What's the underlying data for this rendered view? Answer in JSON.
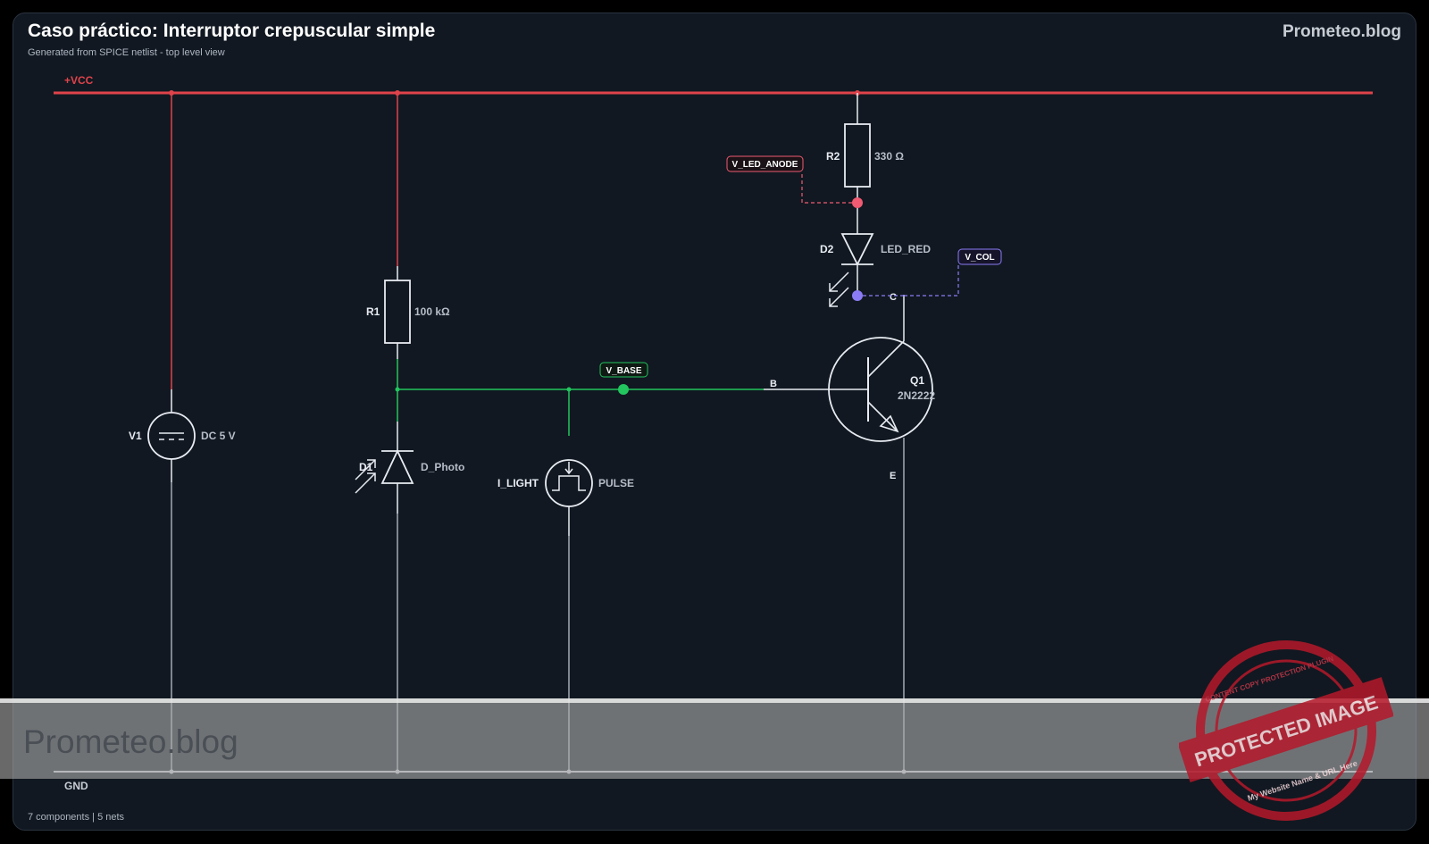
{
  "header": {
    "title": "Caso práctico: Interruptor crepuscular simple",
    "subtitle": "Generated from SPICE netlist - top level view",
    "brand": "Prometeo.blog"
  },
  "footer": {
    "stats": "7 components | 5 nets"
  },
  "rails": {
    "vcc": "+VCC",
    "gnd": "GND"
  },
  "components": {
    "v1": {
      "ref": "V1",
      "value": "DC 5 V"
    },
    "r1": {
      "ref": "R1",
      "value": "100 kΩ"
    },
    "d1": {
      "ref": "D1",
      "value": "D_Photo"
    },
    "ilight": {
      "ref": "I_LIGHT",
      "value": "PULSE"
    },
    "r2": {
      "ref": "R2",
      "value": "330 Ω"
    },
    "d2": {
      "ref": "D2",
      "value": "LED_RED"
    },
    "q1": {
      "ref": "Q1",
      "value": "2N2222",
      "pin_b": "B",
      "pin_c": "C",
      "pin_e": "E"
    }
  },
  "nets": {
    "v_base": "V_BASE",
    "v_led_anode": "V_LED_ANODE",
    "v_col": "V_COL"
  },
  "colors": {
    "vcc": "#e0434b",
    "gnd": "#c9ced6",
    "base": "#22c55e",
    "anode": "#f05a72",
    "collector": "#8b7cf6",
    "wire": "#e8ecf2"
  },
  "watermark": {
    "text": "Prometeo.blog",
    "stamp_main": "PROTECTED IMAGE",
    "stamp_top": "CONTENT COPY PROTECTION PLUGIN",
    "stamp_bottom": "My Website Name & URL Here"
  }
}
